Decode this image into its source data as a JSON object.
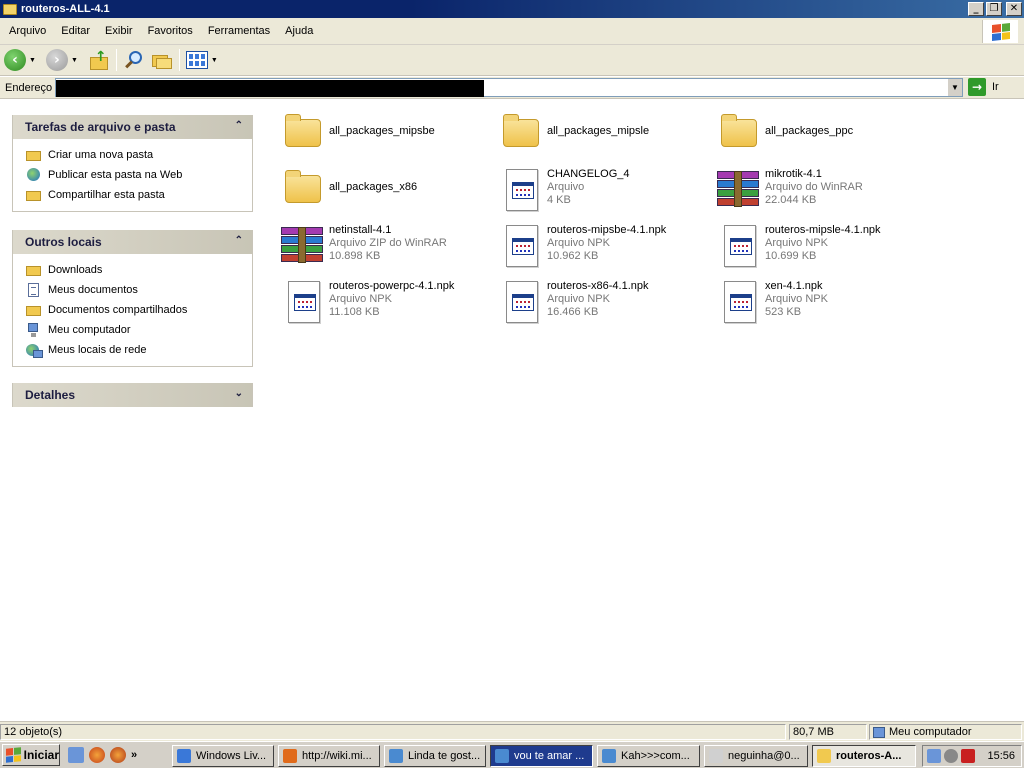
{
  "window": {
    "title": "routeros-ALL-4.1"
  },
  "menubar": {
    "items": [
      "Arquivo",
      "Editar",
      "Exibir",
      "Favoritos",
      "Ferramentas",
      "Ajuda"
    ]
  },
  "address": {
    "label": "Endereço",
    "go_label": "Ir"
  },
  "left_panel": {
    "tasks": {
      "title": "Tarefas de arquivo e pasta",
      "items": [
        {
          "label": "Criar uma nova pasta",
          "icon": "new-folder-icon"
        },
        {
          "label": "Publicar esta pasta na Web",
          "icon": "publish-web-icon"
        },
        {
          "label": "Compartilhar esta pasta",
          "icon": "share-folder-icon"
        }
      ]
    },
    "places": {
      "title": "Outros locais",
      "items": [
        {
          "label": "Downloads",
          "icon": "folder-icon"
        },
        {
          "label": "Meus documentos",
          "icon": "documents-icon"
        },
        {
          "label": "Documentos compartilhados",
          "icon": "folder-icon"
        },
        {
          "label": "Meu computador",
          "icon": "computer-icon"
        },
        {
          "label": "Meus locais de rede",
          "icon": "network-icon"
        }
      ]
    },
    "details": {
      "title": "Detalhes"
    }
  },
  "files": [
    {
      "name": "all_packages_mipsbe",
      "type": "",
      "size": "",
      "icon": "folder"
    },
    {
      "name": "all_packages_mipsle",
      "type": "",
      "size": "",
      "icon": "folder"
    },
    {
      "name": "all_packages_ppc",
      "type": "",
      "size": "",
      "icon": "folder"
    },
    {
      "name": "all_packages_x86",
      "type": "",
      "size": "",
      "icon": "folder"
    },
    {
      "name": "CHANGELOG_4",
      "type": "Arquivo",
      "size": "4 KB",
      "icon": "file"
    },
    {
      "name": "mikrotik-4.1",
      "type": "Arquivo do WinRAR",
      "size": "22.044 KB",
      "icon": "rar"
    },
    {
      "name": "netinstall-4.1",
      "type": "Arquivo ZIP do WinRAR",
      "size": "10.898 KB",
      "icon": "rar"
    },
    {
      "name": "routeros-mipsbe-4.1.npk",
      "type": "Arquivo NPK",
      "size": "10.962 KB",
      "icon": "file"
    },
    {
      "name": "routeros-mipsle-4.1.npk",
      "type": "Arquivo NPK",
      "size": "10.699 KB",
      "icon": "file"
    },
    {
      "name": "routeros-powerpc-4.1.npk",
      "type": "Arquivo NPK",
      "size": "11.108 KB",
      "icon": "file"
    },
    {
      "name": "routeros-x86-4.1.npk",
      "type": "Arquivo NPK",
      "size": "16.466 KB",
      "icon": "file"
    },
    {
      "name": "xen-4.1.npk",
      "type": "Arquivo NPK",
      "size": "523 KB",
      "icon": "file"
    }
  ],
  "statusbar": {
    "count": "12 objeto(s)",
    "size": "80,7 MB",
    "location": "Meu computador"
  },
  "taskbar": {
    "start_label": "Iniciar",
    "quick_more": "»",
    "tasks": [
      {
        "label": "Windows Liv...",
        "state": "normal",
        "color": "#3a78d8"
      },
      {
        "label": "http://wiki.mi...",
        "state": "normal",
        "color": "#e06a1a"
      },
      {
        "label": "Linda te gost...",
        "state": "normal",
        "color": "#4a8ad0"
      },
      {
        "label": "vou te amar ...",
        "state": "active",
        "color": "#4a8ad0"
      },
      {
        "label": "Kah>>>com...",
        "state": "normal",
        "color": "#4a8ad0"
      },
      {
        "label": "neguinha@0...",
        "state": "normal",
        "color": "#d0d0d0"
      },
      {
        "label": "routeros-A...",
        "state": "pressed",
        "color": "#f1c94f"
      }
    ],
    "clock": "15:56"
  }
}
